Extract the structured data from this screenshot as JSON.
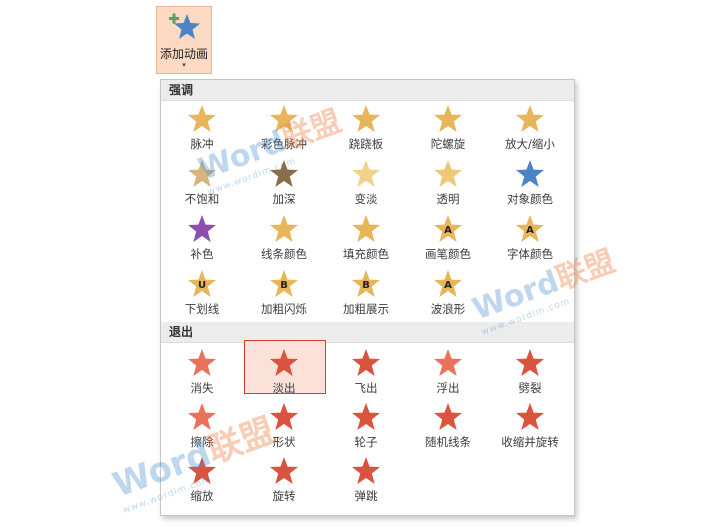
{
  "button": {
    "label": "添加动画",
    "arrow": "▾",
    "icon": "add-star-icon"
  },
  "sections": [
    {
      "title": "强调",
      "items": [
        {
          "label": "脉冲",
          "color": "#e9b55a",
          "icon": "star-pulse-icon"
        },
        {
          "label": "彩色脉冲",
          "color": "#e9b55a",
          "icon": "star-color-pulse-icon"
        },
        {
          "label": "跷跷板",
          "color": "#e9b55a",
          "icon": "star-teeter-icon"
        },
        {
          "label": "陀螺旋",
          "color": "#e9b55a",
          "icon": "star-spin-icon"
        },
        {
          "label": "放大/缩小",
          "color": "#e9b55a",
          "icon": "star-grow-shrink-icon"
        },
        {
          "label": "不饱和",
          "color": "#d8b57c",
          "icon": "star-desaturate-icon"
        },
        {
          "label": "加深",
          "color": "#8a6d4a",
          "icon": "star-darken-icon"
        },
        {
          "label": "变淡",
          "color": "#f1d28c",
          "icon": "star-lighten-icon"
        },
        {
          "label": "透明",
          "color": "#f0c677",
          "icon": "star-transparency-icon"
        },
        {
          "label": "对象颜色",
          "color": "#4a84c5",
          "icon": "star-object-color-icon"
        },
        {
          "label": "补色",
          "color": "#8a4fb0",
          "icon": "star-complementary-color-icon"
        },
        {
          "label": "线条颜色",
          "color": "#e9b55a",
          "icon": "star-line-color-icon"
        },
        {
          "label": "填充颜色",
          "color": "#e9b55a",
          "icon": "star-fill-color-icon"
        },
        {
          "label": "画笔颜色",
          "color": "#e9b55a",
          "icon": "star-brush-color-icon",
          "glyph": "A"
        },
        {
          "label": "字体颜色",
          "color": "#e9b55a",
          "icon": "star-font-color-icon",
          "glyph": "A"
        },
        {
          "label": "下划线",
          "color": "#e9b55a",
          "icon": "star-underline-icon",
          "glyph": "U"
        },
        {
          "label": "加粗闪烁",
          "color": "#e9b55a",
          "icon": "star-bold-flash-icon",
          "glyph": "B"
        },
        {
          "label": "加粗展示",
          "color": "#e9b55a",
          "icon": "star-bold-reveal-icon",
          "glyph": "B"
        },
        {
          "label": "波浪形",
          "color": "#e9b55a",
          "icon": "star-wave-icon",
          "glyph": "A"
        }
      ]
    },
    {
      "title": "退出",
      "items": [
        {
          "label": "消失",
          "color": "#e8735a",
          "icon": "star-disappear-icon"
        },
        {
          "label": "淡出",
          "color": "#d9533f",
          "icon": "star-fade-icon",
          "selected": true
        },
        {
          "label": "飞出",
          "color": "#d9533f",
          "icon": "star-fly-out-icon"
        },
        {
          "label": "浮出",
          "color": "#e8735a",
          "icon": "star-float-out-icon"
        },
        {
          "label": "劈裂",
          "color": "#d9533f",
          "icon": "star-split-icon"
        },
        {
          "label": "擦除",
          "color": "#e8735a",
          "icon": "star-wipe-icon"
        },
        {
          "label": "形状",
          "color": "#d9533f",
          "icon": "star-shape-icon"
        },
        {
          "label": "轮子",
          "color": "#d9533f",
          "icon": "star-wheel-icon"
        },
        {
          "label": "随机线条",
          "color": "#d9533f",
          "icon": "star-random-bars-icon"
        },
        {
          "label": "收缩并旋转",
          "color": "#d9533f",
          "icon": "star-shrink-turn-icon"
        },
        {
          "label": "缩放",
          "color": "#d9533f",
          "icon": "star-zoom-icon"
        },
        {
          "label": "旋转",
          "color": "#d9533f",
          "icon": "star-swivel-icon"
        },
        {
          "label": "弹跳",
          "color": "#d9533f",
          "icon": "star-bounce-icon"
        }
      ]
    }
  ],
  "watermark": {
    "brand": "Word",
    "brand_cn": "联盟",
    "url": "www.wordlm.com"
  }
}
